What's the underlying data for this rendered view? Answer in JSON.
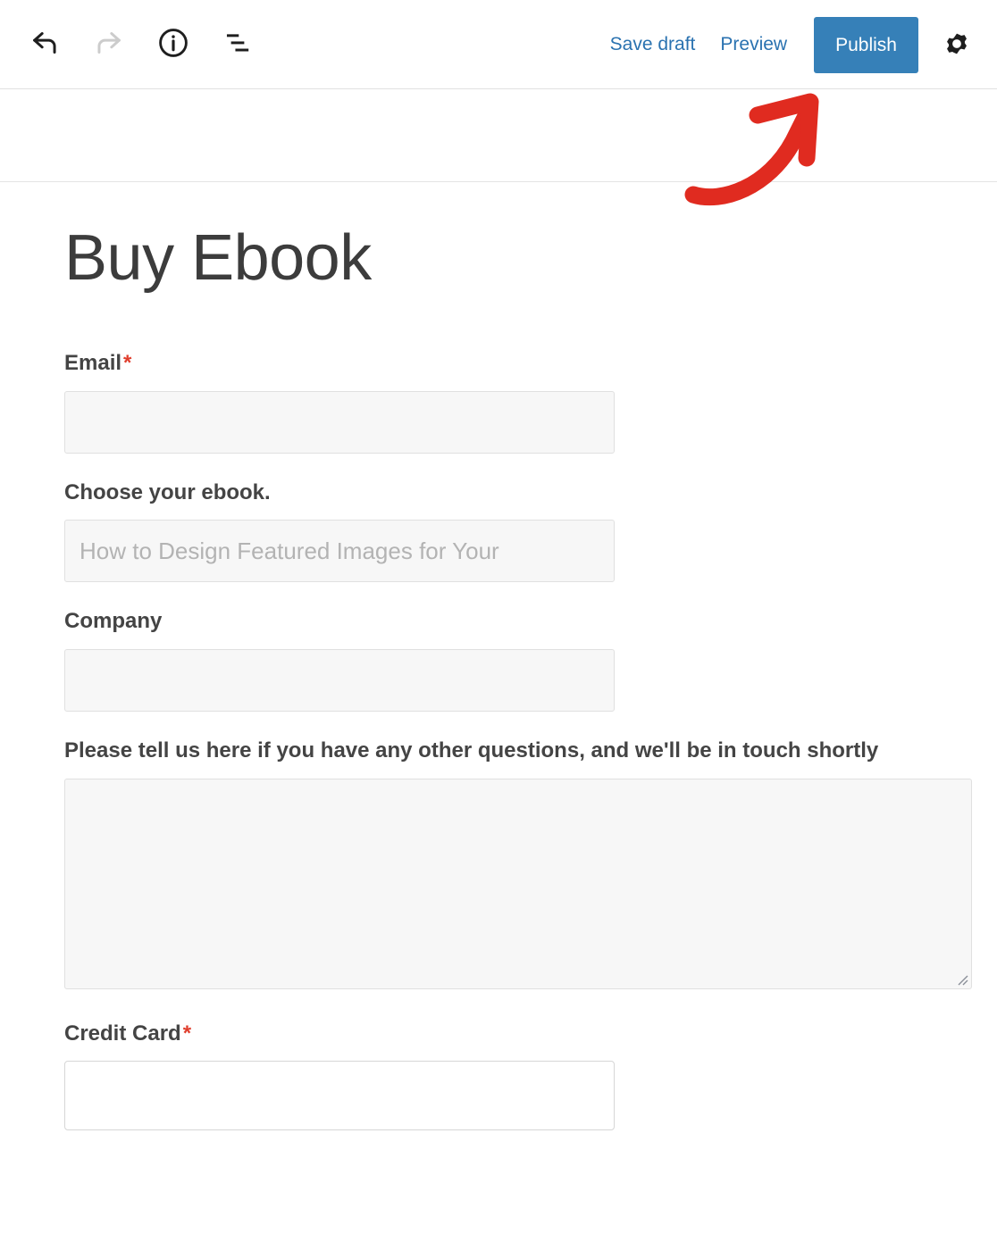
{
  "toolbar": {
    "icons": [
      {
        "name": "undo-icon",
        "state": "enabled"
      },
      {
        "name": "redo-icon",
        "state": "disabled"
      },
      {
        "name": "info-icon",
        "state": "enabled"
      },
      {
        "name": "list-view-icon",
        "state": "enabled"
      }
    ],
    "save_draft_label": "Save draft",
    "preview_label": "Preview",
    "publish_label": "Publish",
    "settings_icon": "gear-icon",
    "colors": {
      "link": "#2a72b0",
      "publish_bg": "#3680b8",
      "publish_text": "#ffffff",
      "annotation_arrow": "#e02b20"
    }
  },
  "post": {
    "title": "Buy Ebook"
  },
  "form": {
    "fields": [
      {
        "id": "email",
        "label": "Email",
        "required": true,
        "required_marker": "*",
        "type": "text",
        "value": "",
        "placeholder": ""
      },
      {
        "id": "ebook",
        "label": "Choose your ebook.",
        "required": false,
        "required_marker": "",
        "type": "select",
        "value": "How to Design Featured Images for Your",
        "placeholder": ""
      },
      {
        "id": "company",
        "label": "Company",
        "required": false,
        "required_marker": "",
        "type": "text",
        "value": "",
        "placeholder": ""
      },
      {
        "id": "message",
        "label": "Please tell us here if you have any other questions, and we'll be in touch shortly",
        "required": false,
        "required_marker": "",
        "type": "textarea",
        "value": "",
        "placeholder": ""
      },
      {
        "id": "credit-card",
        "label": "Credit Card",
        "required": true,
        "required_marker": "*",
        "type": "creditcard",
        "value": "",
        "placeholder": ""
      }
    ]
  }
}
